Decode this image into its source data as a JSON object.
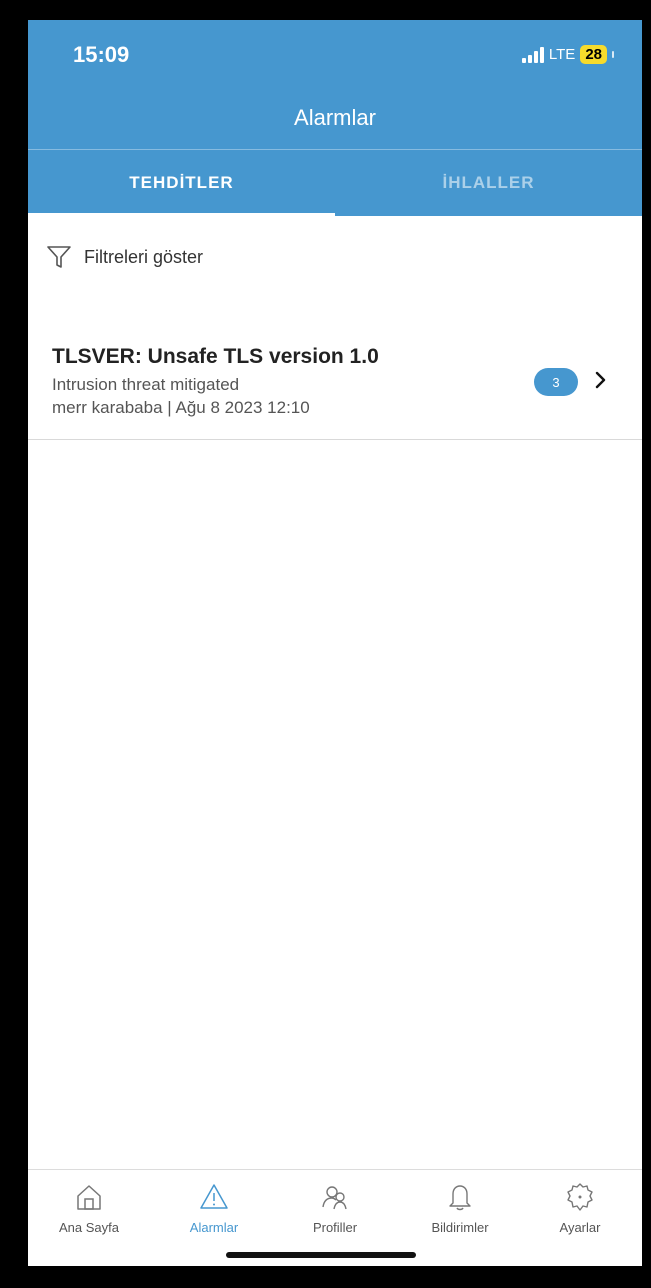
{
  "status_bar": {
    "time": "15:09",
    "network": "LTE",
    "battery": "28"
  },
  "header": {
    "title": "Alarmlar"
  },
  "tabs": [
    {
      "label": "TEHDİTLER",
      "active": true
    },
    {
      "label": "İHLALLER",
      "active": false
    }
  ],
  "filter": {
    "label": "Filtreleri göster",
    "icon": "filter-icon"
  },
  "alarms": [
    {
      "title": "TLSVER: Unsafe TLS version 1.0",
      "status": "Intrusion threat mitigated",
      "meta": "merr karababa | Ağu 8 2023 12:10",
      "count": "3"
    }
  ],
  "bottom_nav": [
    {
      "label": "Ana Sayfa",
      "icon": "home-icon",
      "active": false
    },
    {
      "label": "Alarmlar",
      "icon": "warning-icon",
      "active": true
    },
    {
      "label": "Profiller",
      "icon": "profiles-icon",
      "active": false
    },
    {
      "label": "Bildirimler",
      "icon": "bell-icon",
      "active": false
    },
    {
      "label": "Ayarlar",
      "icon": "gear-icon",
      "active": false
    }
  ],
  "colors": {
    "accent": "#4697cf",
    "battery": "#f7db2c",
    "inactive_icon": "#777777"
  }
}
